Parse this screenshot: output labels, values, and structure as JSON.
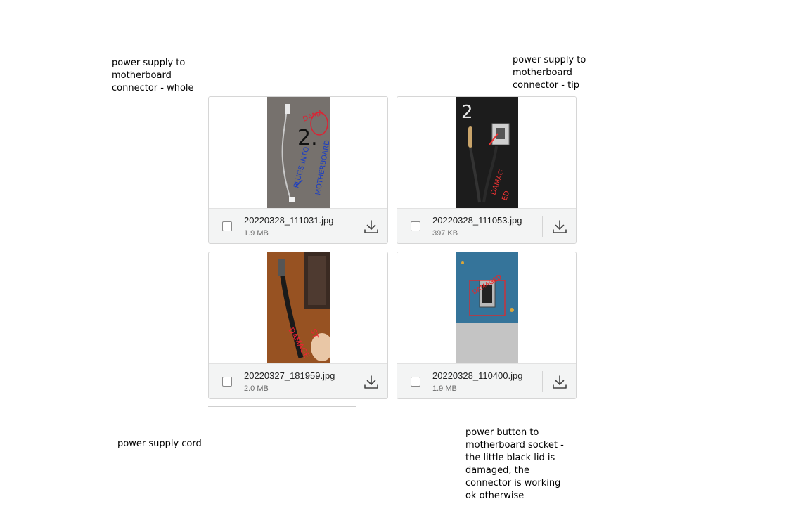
{
  "notes": {
    "top_left": "power supply to\nmotherboard\nconnector - whole",
    "top_right": "power supply to\nmotherboard\nconnector - tip",
    "bottom_left": "power supply cord",
    "bottom_right": "power button to\nmotherboard socket -\nthe little black lid is\ndamaged, the\nconnector is working\nok otherwise"
  },
  "attachments": [
    {
      "filename": "20220328_111031.jpg",
      "size": "1.9 MB"
    },
    {
      "filename": "20220328_111053.jpg",
      "size": "397 KB"
    },
    {
      "filename": "20220327_181959.jpg",
      "size": "2.0 MB"
    },
    {
      "filename": "20220328_110400.jpg",
      "size": "1.9 MB"
    }
  ],
  "icons": {
    "checkbox": "checkbox-icon",
    "download": "download-icon"
  },
  "colors": {
    "footer_bg": "#f3f4f4",
    "border": "#d6d6d6",
    "icon": "#444444"
  }
}
